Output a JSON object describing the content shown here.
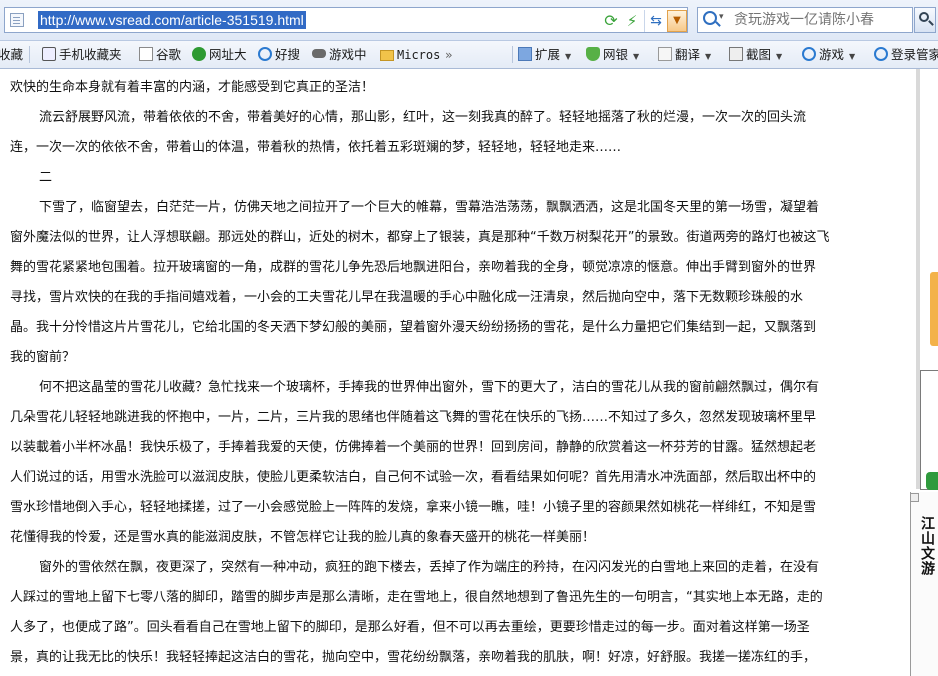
{
  "browser": {
    "url": "http://www.vsread.com/article-351519.html",
    "search_placeholder": "贪玩游戏一亿请陈小春"
  },
  "favorites_bar": {
    "items": [
      {
        "label": "收藏",
        "icon": "star-icon"
      },
      {
        "label": "手机收藏夹",
        "icon": "phone-icon"
      },
      {
        "label": "谷歌",
        "icon": "page-icon"
      },
      {
        "label": "网址大",
        "icon": "nav-icon"
      },
      {
        "label": "好搜",
        "icon": "haosou-icon"
      },
      {
        "label": "游戏中",
        "icon": "gamepad-icon"
      },
      {
        "label": "Micros",
        "icon": "folder-icon"
      }
    ],
    "more_chevron": "»",
    "tools": [
      {
        "label": "扩展",
        "icon": "puzzle-icon"
      },
      {
        "label": "网银",
        "icon": "shield-icon"
      },
      {
        "label": "翻译",
        "icon": "translate-icon"
      },
      {
        "label": "截图",
        "icon": "screenshot-icon"
      },
      {
        "label": "游戏",
        "icon": "game-search-icon"
      },
      {
        "label": "登录管家",
        "icon": "login-icon"
      }
    ]
  },
  "article": {
    "lines": [
      "欢快的生命本身就有着丰富的内涵，才能感受到它真正的圣洁！",
      "流云舒展野风流，带着依依的不舍，带着美好的心情，那山影，红叶，这一刻我真的醉了。轻轻地摇落了秋的烂漫，一次一次的回头流",
      "连，一次一次的依依不舍，带着山的体温，带着秋的热情，依托着五彩斑斓的梦，轻轻地，轻轻地走来……",
      "二",
      "下雪了，临窗望去，白茫茫一片，仿佛天地之间拉开了一个巨大的帷幕，雪幕浩浩荡荡，飘飘洒洒，这是北国冬天里的第一场雪，凝望着",
      "窗外魔法似的世界，让人浮想联翩。那远处的群山，近处的树木，都穿上了银装，真是那种“千数万树梨花开”的景致。街道两旁的路灯也被这飞",
      "舞的雪花紧紧地包围着。拉开玻璃窗的一角，成群的雪花儿争先恐后地飘进阳台，亲吻着我的全身，顿觉凉凉的惬意。伸出手臂到窗外的世界",
      "寻找，雪片欢快的在我的手指间嬉戏着，一小会的工夫雪花儿早在我温暖的手心中融化成一汪清泉，然后抛向空中，落下无数颗珍珠般的水",
      "晶。我十分怜惜这片片雪花儿，它给北国的冬天洒下梦幻般的美丽，望着窗外漫天纷纷扬扬的雪花，是什么力量把它们集结到一起，又飘落到",
      "我的窗前？",
      "何不把这晶莹的雪花儿收藏？急忙找来一个玻璃杯，手捧我的世界伸出窗外，雪下的更大了，洁白的雪花儿从我的窗前翩然飘过，偶尔有",
      "几朵雪花儿轻轻地跳进我的怀抱中，一片，二片，三片我的思绪也伴随着这飞舞的雪花在快乐的飞扬……不知过了多久，忽然发现玻璃杯里早",
      "以装載着小半杯冰晶！我快乐极了，手捧着我爱的天使，仿佛捧着一个美丽的世界！回到房间，静静的欣赏着这一杯芬芳的甘露。猛然想起老",
      "人们说过的话，用雪水洗脸可以滋润皮肤，使脸儿更柔软洁白，自己何不试验一次，看看结果如何呢？首先用清水冲洗面部，然后取出杯中的",
      "雪水珍惜地倒入手心，轻轻地揉搓，过了一小会感觉脸上一阵阵的发烧，拿来小镜一瞧，哇！小镜子里的容颜果然如桃花一样绯红，不知是雪",
      "花懂得我的怜爱，还是雪水真的能滋润皮肤，不管怎样它让我的脸儿真的象春天盛开的桃花一样美丽！",
      "窗外的雪依然在飘，夜更深了，突然有一种冲动，疯狂的跑下楼去，丢掉了作为端庄的矜持，在闪闪发光的白雪地上来回的走着，在没有",
      "人踩过的雪地上留下七零八落的脚印，踏雪的脚步声是那么清晰，走在雪地上，很自然地想到了鲁迅先生的一句明言，“其实地上本无路，走的",
      "人多了，也便成了路”。回头看看自己在雪地上留下的脚印，是那么好看，但不可以再去重绘，更要珍惜走过的每一步。面对着这样第一场圣",
      "景，真的让我无比的快乐！我轻轻捧起这洁白的雪花，抛向空中，雪花纷纷飘落，亲吻着我的肌肤，啊！好凉，好舒服。我搓一搓冻红的手，"
    ]
  },
  "side_panel": {
    "title": "江山文游"
  },
  "colors": {
    "url_highlight": "#316ac5",
    "toolbar_bg": "#e4ebf6",
    "side_orange": "#f3b24a",
    "side_green": "#2f9a3d"
  }
}
